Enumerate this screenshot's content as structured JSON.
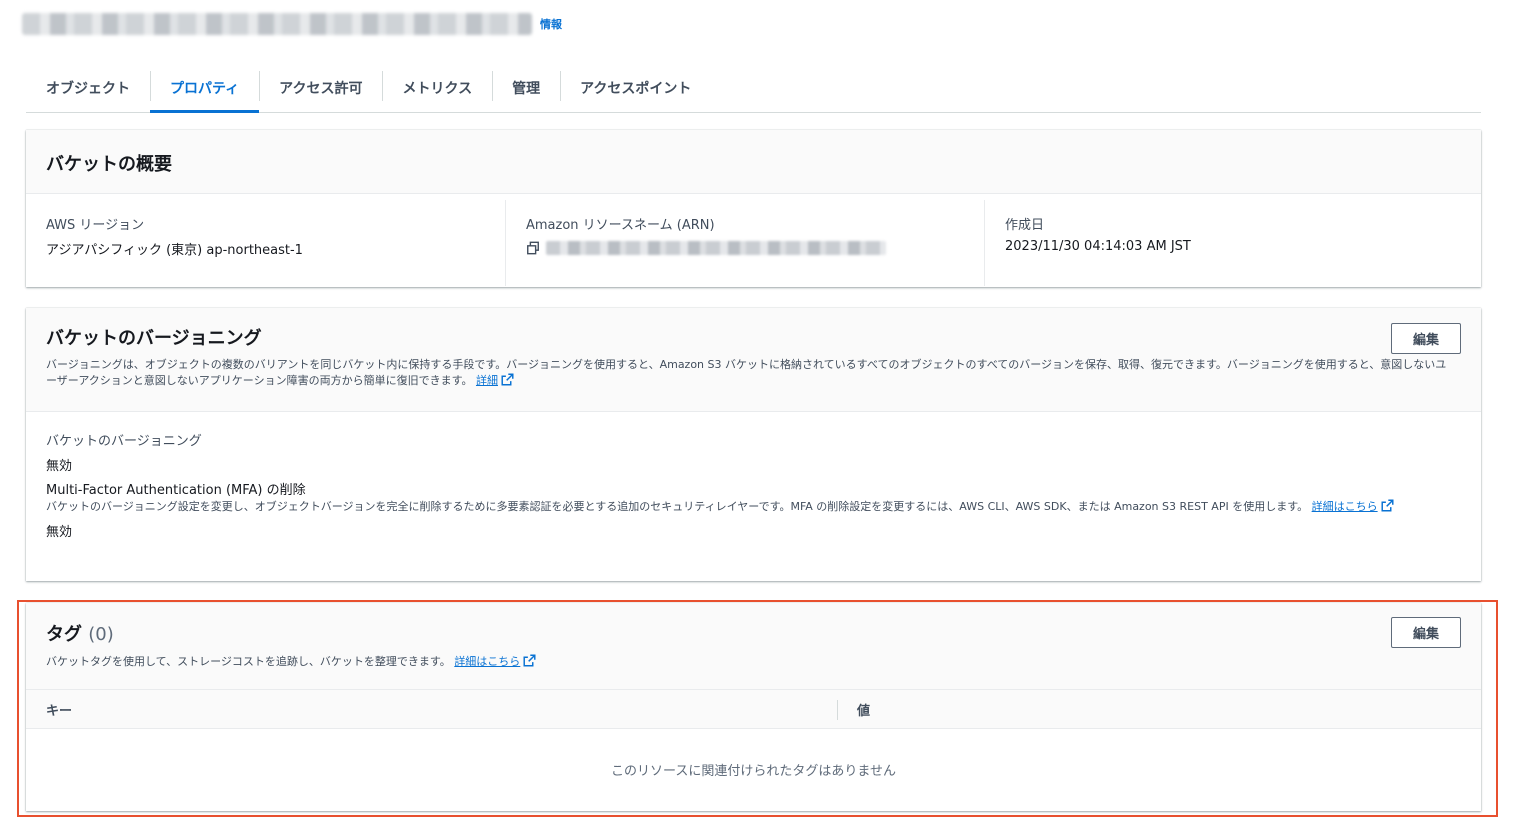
{
  "header": {
    "info_link": "情報"
  },
  "tabs": [
    {
      "label": "オブジェクト",
      "active": false
    },
    {
      "label": "プロパティ",
      "active": true
    },
    {
      "label": "アクセス許可",
      "active": false
    },
    {
      "label": "メトリクス",
      "active": false
    },
    {
      "label": "管理",
      "active": false
    },
    {
      "label": "アクセスポイント",
      "active": false
    }
  ],
  "overview": {
    "title": "バケットの概要",
    "region_label": "AWS リージョン",
    "region_value": "アジアパシフィック (東京) ap-northeast-1",
    "arn_label": "Amazon リソースネーム (ARN)",
    "created_label": "作成日",
    "created_value": "2023/11/30 04:14:03 AM JST"
  },
  "versioning": {
    "title": "バケットのバージョニング",
    "edit_label": "編集",
    "description": "バージョニングは、オブジェクトの複数のバリアントを同じバケット内に保持する手段です。バージョニングを使用すると、Amazon S3 バケットに格納されているすべてのオブジェクトのすべてのバージョンを保存、取得、復元できます。バージョニングを使用すると、意図しないユーザーアクションと意図しないアプリケーション障害の両方から簡単に復旧できます。",
    "learn_more": "詳細",
    "status_label": "バケットのバージョニング",
    "status_value": "無効",
    "mfa_label": "Multi-Factor Authentication (MFA) の削除",
    "mfa_description": "バケットのバージョニング設定を変更し、オブジェクトバージョンを完全に削除するために多要素認証を必要とする追加のセキュリティレイヤーです。MFA の削除設定を変更するには、AWS CLI、AWS SDK、または Amazon S3 REST API を使用します。",
    "mfa_learn_more": "詳細はこちら",
    "mfa_value": "無効"
  },
  "tags": {
    "title": "タグ",
    "count": "(0)",
    "edit_label": "編集",
    "description": "バケットタグを使用して、ストレージコストを追跡し、バケットを整理できます。",
    "learn_more": "詳細はこちら",
    "col_key": "キー",
    "col_value": "値",
    "empty_message": "このリソースに関連付けられたタグはありません"
  },
  "colors": {
    "link": "#0972d3",
    "highlight": "#e8502f"
  }
}
